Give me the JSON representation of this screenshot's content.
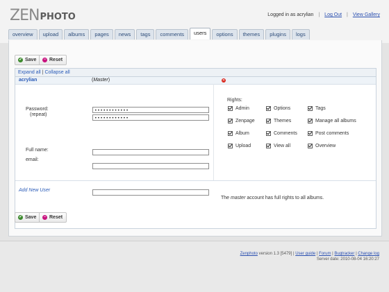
{
  "logo": {
    "zen": "ZEN",
    "photo": "PHOTO"
  },
  "userbar": {
    "logged_in": "Logged in as acrylian",
    "separator": "|",
    "logout": "Log Out",
    "view_gallery": "View Gallery"
  },
  "tabs": [
    {
      "label": "overview",
      "active": false
    },
    {
      "label": "upload",
      "active": false
    },
    {
      "label": "albums",
      "active": false
    },
    {
      "label": "pages",
      "active": false
    },
    {
      "label": "news",
      "active": false
    },
    {
      "label": "tags",
      "active": false
    },
    {
      "label": "comments",
      "active": false
    },
    {
      "label": "users",
      "active": true
    },
    {
      "label": "options",
      "active": false
    },
    {
      "label": "themes",
      "active": false
    },
    {
      "label": "plugins",
      "active": false
    },
    {
      "label": "logs",
      "active": false
    }
  ],
  "buttons": {
    "save": "Save",
    "reset": "Reset"
  },
  "expand": {
    "expand_all": "Expand all",
    "separator": "|",
    "collapse_all": "Collapse all"
  },
  "user": {
    "name": "acrylian",
    "master_open": "(",
    "master_word": "Master",
    "master_close": ")"
  },
  "form": {
    "password_label": "Password:",
    "repeat_label": "(repeat)",
    "password_value": "••••••••••••",
    "repeat_value": "••••••••••••",
    "fullname_label": "Full name:",
    "email_label": "email:",
    "fullname_value": "",
    "email_value": "",
    "add_new_user": "Add New User",
    "new_user_value": ""
  },
  "rights": {
    "title": "Rights:",
    "items": [
      {
        "label": "Admin",
        "checked": true
      },
      {
        "label": "Options",
        "checked": true
      },
      {
        "label": "Tags",
        "checked": true
      },
      {
        "label": "Zenpage",
        "checked": true
      },
      {
        "label": "Themes",
        "checked": true
      },
      {
        "label": "Manage all albums",
        "checked": true
      },
      {
        "label": "Album",
        "checked": true
      },
      {
        "label": "Comments",
        "checked": true
      },
      {
        "label": "Post comments",
        "checked": true
      },
      {
        "label": "Upload",
        "checked": true
      },
      {
        "label": "View all",
        "checked": true
      },
      {
        "label": "Overview",
        "checked": true
      }
    ],
    "note_prefix": "The ",
    "note_master": "master",
    "note_suffix": " account has full rights to all albums."
  },
  "footer": {
    "brand": "Zenphoto",
    "version": " version 1.3 [5479] |",
    "user_guide": "User guide",
    "forum": "Forum",
    "bugtracker": "Bugtracker",
    "changelog": "Change log",
    "separator": "|",
    "server_date": "Server date: 2010-08-04 16:20:27"
  },
  "colors": {
    "link": "#2a5bb8",
    "ok_icon": "#3d8a2e",
    "reset_icon": "#c8127e",
    "delete_icon": "#d9261c"
  }
}
